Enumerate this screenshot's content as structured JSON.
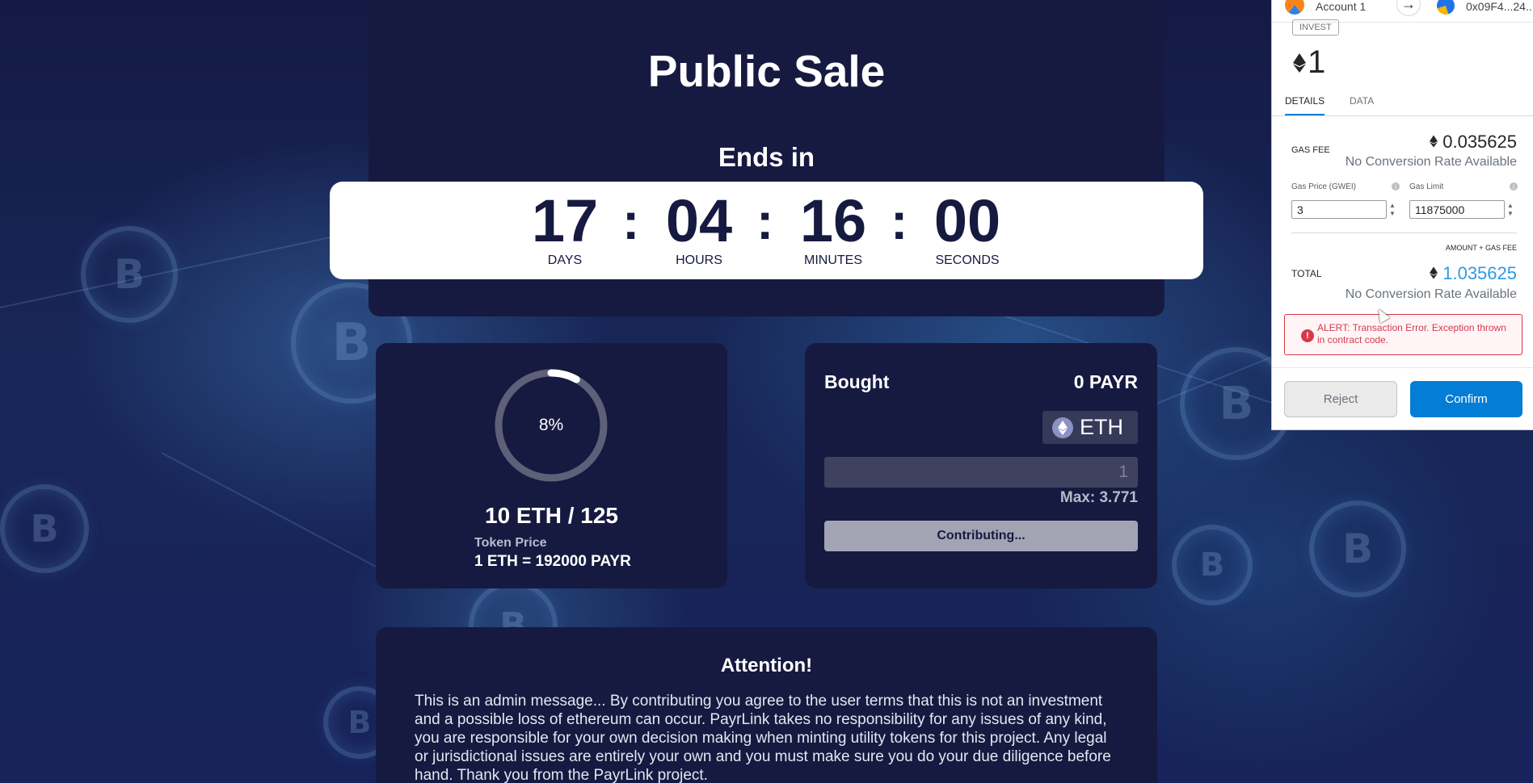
{
  "hero": {
    "title": "Public Sale",
    "ends_in": "Ends in",
    "countdown": [
      {
        "value": "17",
        "label": "DAYS"
      },
      {
        "value": "04",
        "label": "HOURS"
      },
      {
        "value": "16",
        "label": "MINUTES"
      },
      {
        "value": "00",
        "label": "SECONDS"
      }
    ],
    "separator": ":"
  },
  "progress": {
    "percent_label": "8%",
    "percent_value": 0.08,
    "raised": "10 ETH / 125",
    "token_price_label": "Token Price",
    "token_price_value": "1 ETH = 192000 PAYR"
  },
  "buy": {
    "bought_label": "Bought",
    "bought_value": "0 PAYR",
    "currency": "ETH",
    "amount_value": "1",
    "max_label": "Max: 3.771",
    "contribute_label": "Contributing..."
  },
  "notice": {
    "title": "Attention!",
    "text": "This is an admin message... By contributing you agree to the user terms that this is not an investment and a possible loss of ethereum can occur. PayrLink takes no responsibility for any issues of any kind, you are responsible for your own decision making when minting utility tokens for this project. Any legal or jurisdictional issues are entirely your own and you must make sure you do your due diligence before hand. Thank you from the PayrLink project."
  },
  "metamask": {
    "account": "Account 1",
    "address": "0x09F4...24...",
    "method": "INVEST",
    "amount": "1",
    "tabs": [
      "DETAILS",
      "DATA"
    ],
    "gas_fee_label": "GAS FEE",
    "gas_fee_eth": "0.035625",
    "no_conversion": "No Conversion Rate Available",
    "gas_price_label": "Gas Price (GWEI)",
    "gas_price_value": "3",
    "gas_limit_label": "Gas Limit",
    "gas_limit_value": "11875000",
    "amount_gas_label": "AMOUNT + GAS FEE",
    "total_label": "TOTAL",
    "total_eth": "1.035625",
    "alert": "ALERT: Transaction Error. Exception thrown in contract code.",
    "reject_label": "Reject",
    "confirm_label": "Confirm"
  },
  "colors": {
    "background": "#141a45",
    "card": "#161a40",
    "metamask_blue": "#037dd6",
    "alert_red": "#d73a49",
    "total_blue": "#2f9ae0"
  },
  "icons": [
    "eth-icon",
    "arrow-right-icon",
    "info-icon",
    "alert-icon"
  ]
}
